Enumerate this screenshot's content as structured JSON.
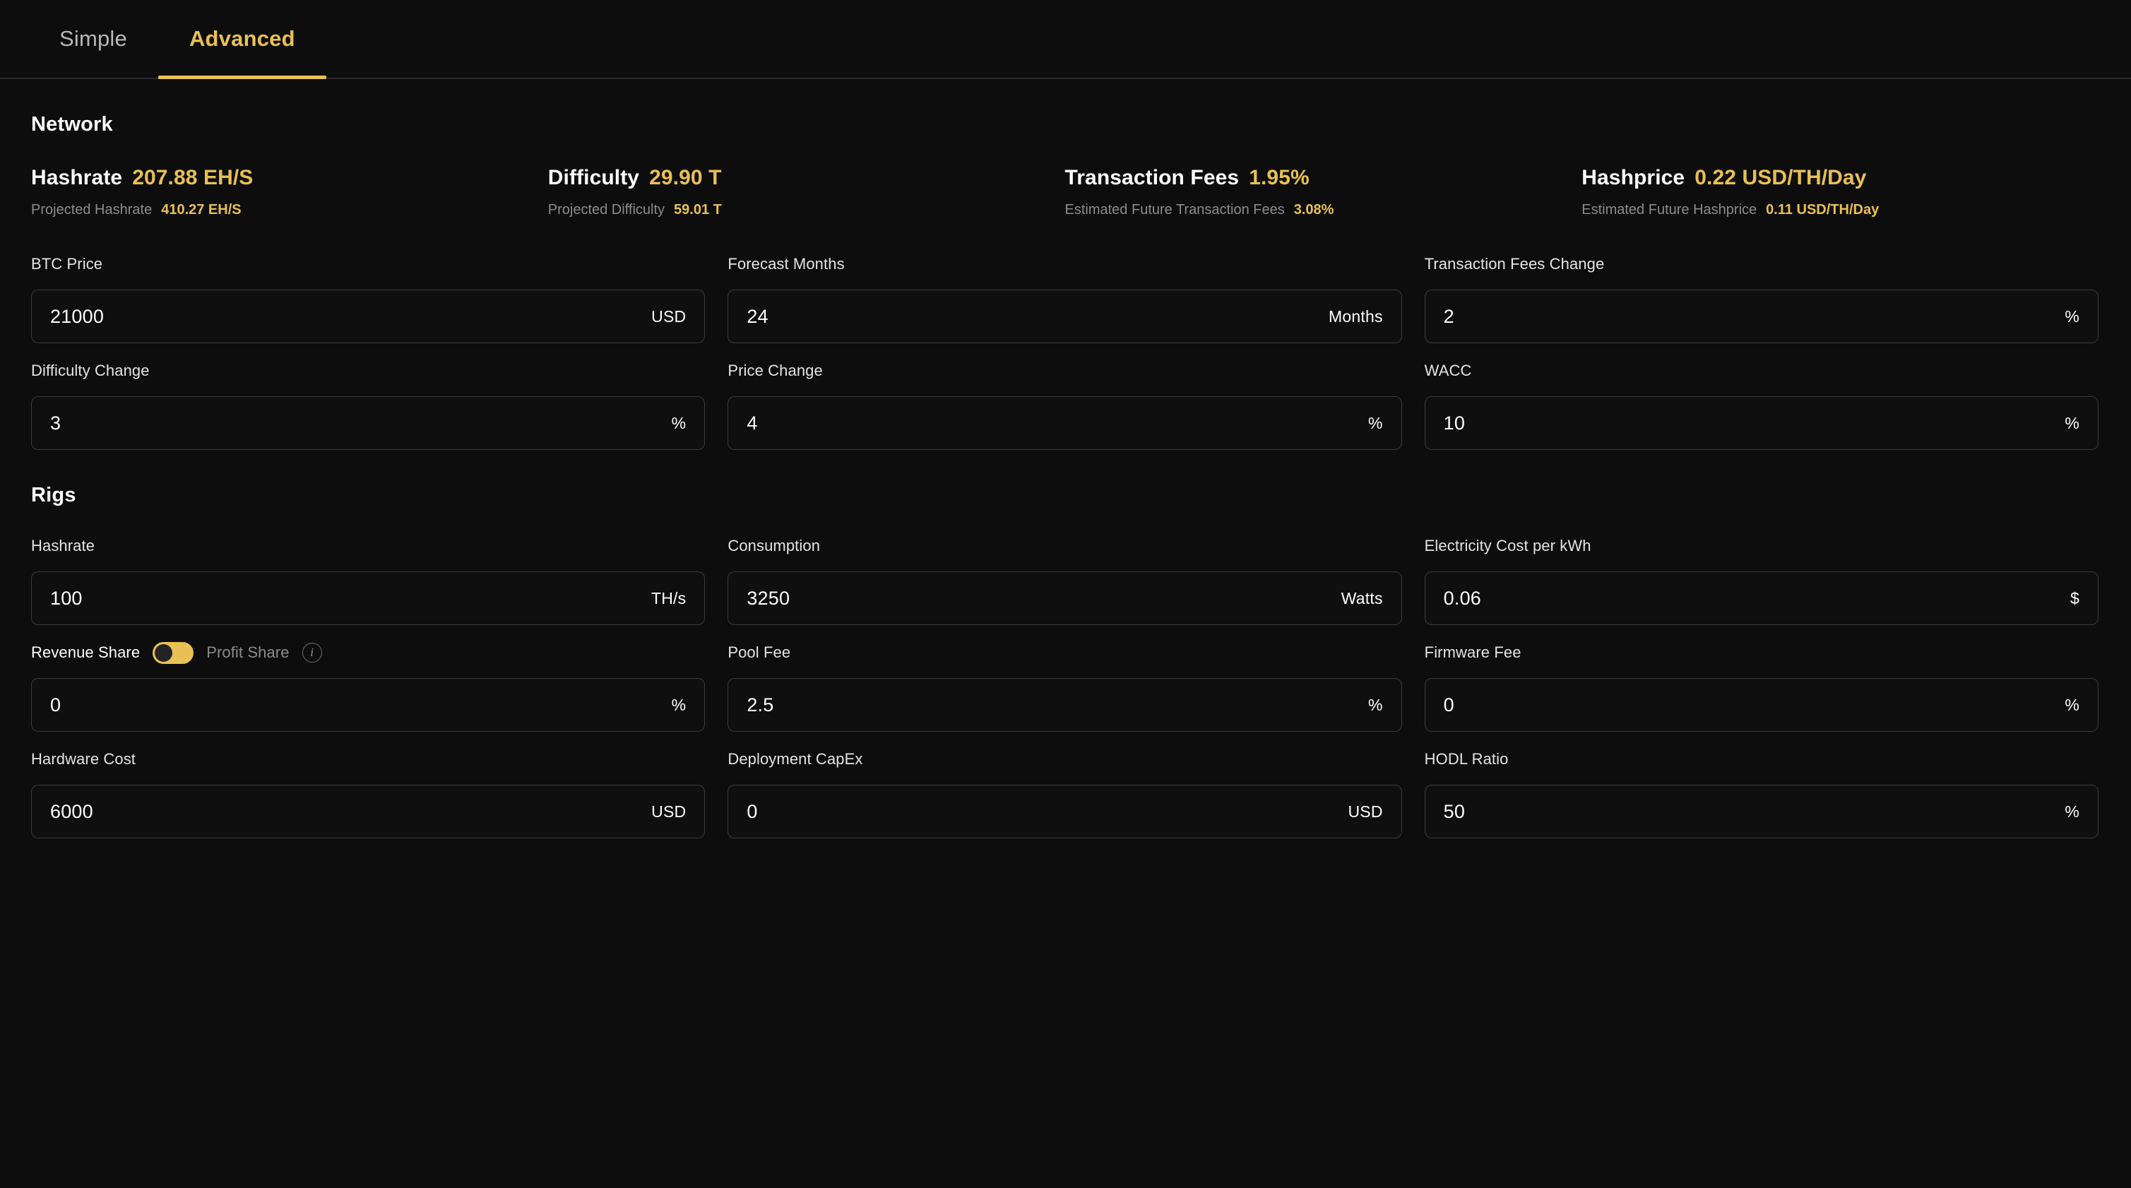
{
  "tabs": [
    {
      "label": "Simple",
      "active": false
    },
    {
      "label": "Advanced",
      "active": true
    }
  ],
  "colors": {
    "accent": "#e8c055",
    "background": "#0d0d0d",
    "text": "#ffffff",
    "muted": "#8c8c8c",
    "border": "#3a3a3d"
  },
  "network": {
    "title": "Network",
    "stats": [
      {
        "name": "Hashrate",
        "value": "207.88 EH/S",
        "sub_name": "Projected Hashrate",
        "sub_value": "410.27 EH/S"
      },
      {
        "name": "Difficulty",
        "value": "29.90 T",
        "sub_name": "Projected Difficulty",
        "sub_value": "59.01 T"
      },
      {
        "name": "Transaction Fees",
        "value": "1.95%",
        "sub_name": "Estimated Future Transaction Fees",
        "sub_value": "3.08%"
      },
      {
        "name": "Hashprice",
        "value": "0.22 USD/TH/Day",
        "sub_name": "Estimated Future Hashprice",
        "sub_value": "0.11 USD/TH/Day"
      }
    ],
    "fields": [
      {
        "label": "BTC Price",
        "value": "21000",
        "unit": "USD"
      },
      {
        "label": "Forecast Months",
        "value": "24",
        "unit": "Months"
      },
      {
        "label": "Transaction Fees Change",
        "value": "2",
        "unit": "%"
      },
      {
        "label": "Difficulty Change",
        "value": "3",
        "unit": "%"
      },
      {
        "label": "Price Change",
        "value": "4",
        "unit": "%"
      },
      {
        "label": "WACC",
        "value": "10",
        "unit": "%"
      }
    ]
  },
  "rigs": {
    "title": "Rigs",
    "fields_row1": [
      {
        "label": "Hashrate",
        "value": "100",
        "unit": "TH/s"
      },
      {
        "label": "Consumption",
        "value": "3250",
        "unit": "Watts"
      },
      {
        "label": "Electricity Cost per kWh",
        "value": "0.06",
        "unit": "$"
      }
    ],
    "revenue_share": {
      "label_on": "Revenue Share",
      "label_off": "Profit Share",
      "toggle_state": "off",
      "info_icon": "info-icon",
      "value": "0",
      "unit": "%"
    },
    "fields_row2": [
      {
        "label": "Pool Fee",
        "value": "2.5",
        "unit": "%"
      },
      {
        "label": "Firmware Fee",
        "value": "0",
        "unit": "%"
      }
    ],
    "fields_row3": [
      {
        "label": "Hardware Cost",
        "value": "6000",
        "unit": "USD"
      },
      {
        "label": "Deployment CapEx",
        "value": "0",
        "unit": "USD"
      },
      {
        "label": "HODL Ratio",
        "value": "50",
        "unit": "%"
      }
    ]
  }
}
